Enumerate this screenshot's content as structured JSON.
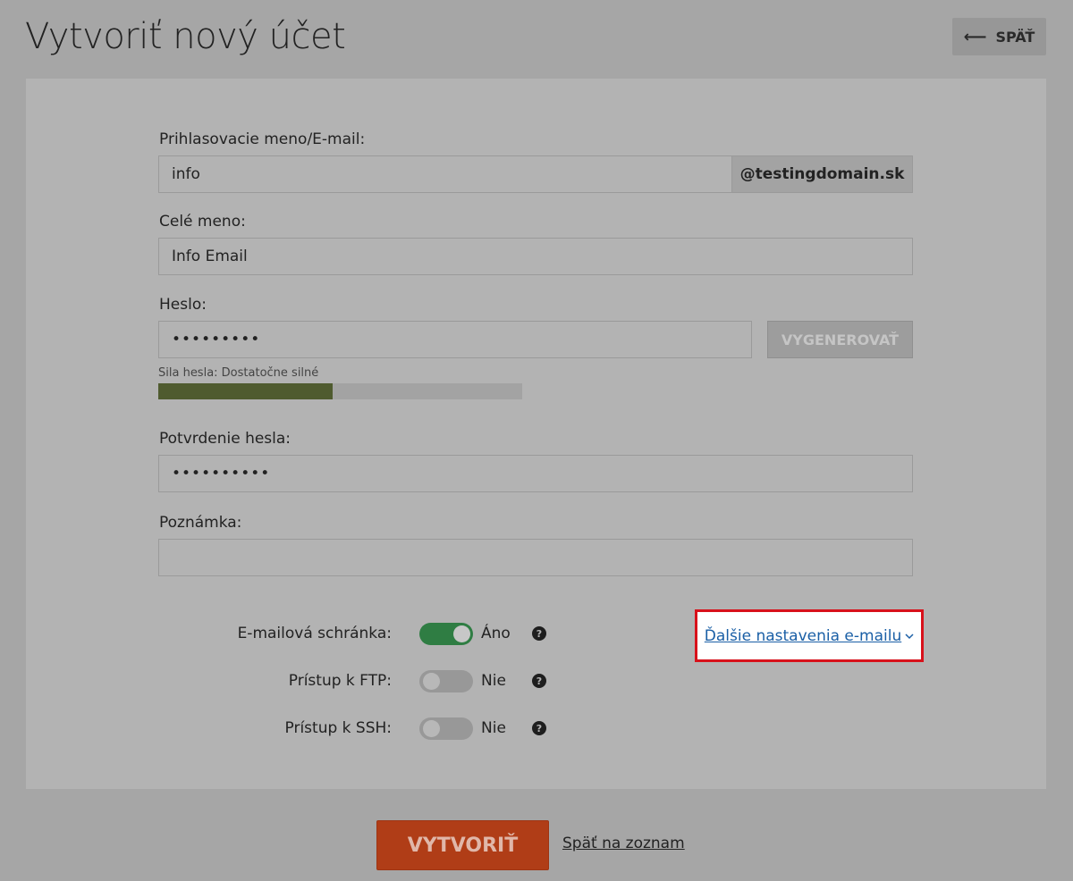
{
  "page": {
    "title": "Vytvoriť nový účet"
  },
  "header": {
    "back_label": "SPÄŤ"
  },
  "form": {
    "login_label": "Prihlasovacie meno/E-mail:",
    "login_value": "info",
    "login_domain": "@testingdomain.sk",
    "fullname_label": "Celé meno:",
    "fullname_value": "Info Email",
    "password_label": "Heslo:",
    "password_value": "•••••••••",
    "generate_label": "VYGENEROVAŤ",
    "strength_label": "Sila hesla: Dostatočne silné",
    "strength_level": 0.48,
    "confirm_label": "Potvrdenie hesla:",
    "confirm_value": "••••••••••",
    "note_label": "Poznámka:",
    "note_value": ""
  },
  "services": [
    {
      "label": "E-mailová schránka:",
      "state": "Áno",
      "on": true
    },
    {
      "label": "Prístup k FTP:",
      "state": "Nie",
      "on": false
    },
    {
      "label": "Prístup k SSH:",
      "state": "Nie",
      "on": false
    }
  ],
  "help_glyph": "?",
  "more_settings_label": "Ďalšie nastavenia e-mailu",
  "footer": {
    "create_label": "VYTVORIŤ",
    "back_to_list_label": "Späť na zoznam"
  },
  "colors": {
    "accent_green": "#2f7d43",
    "create_button": "#b03d17",
    "link": "#1a5fa6",
    "highlight": "#d8111b"
  }
}
